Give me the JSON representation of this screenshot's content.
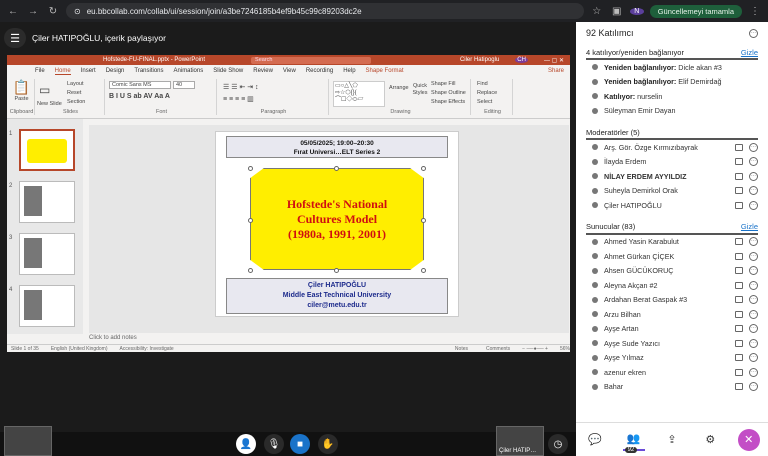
{
  "browser": {
    "url": "eu.bbcollab.com/collab/ui/session/join/a3be7246185b4ef9b45c99c89203dc2e",
    "update": "Güncellemeyi tamamla",
    "profile": "N"
  },
  "share": {
    "text": "Çiler HATIPOĞLU, içerik paylaşıyor"
  },
  "ppt": {
    "file": "Hofstede-FU-FINAL.pptx - PowerPoint",
    "search": "Search",
    "user": "Ciler Hatipoglu",
    "initials": "CH",
    "tabs": [
      "File",
      "Home",
      "Insert",
      "Design",
      "Transitions",
      "Animations",
      "Slide Show",
      "Review",
      "View",
      "Recording",
      "Help",
      "Shape Format"
    ],
    "share": "Share",
    "groups": [
      "Clipboard",
      "Slides",
      "Font",
      "Paragraph",
      "Drawing",
      "Editing"
    ],
    "font": "Comic Sans MS",
    "size": "40",
    "ribbon": {
      "paste": "Paste",
      "new_slide": "New Slide",
      "layout": "Layout",
      "reset": "Reset",
      "section": "Section",
      "arrange": "Arrange",
      "quick_styles": "Quick Styles",
      "shape_fill": "Shape Fill",
      "shape_outline": "Shape Outline",
      "shape_effects": "Shape Effects",
      "find": "Find",
      "replace": "Replace",
      "select": "Select"
    },
    "thumb_nums": [
      "1",
      "2",
      "3",
      "4"
    ],
    "slide": {
      "date": "05/05/2025; 19:00–20:30",
      "event": "Fırat Universi…ELT Series 2",
      "title1": "Hofstede's National",
      "title2": "Cultures Model",
      "title3": "(1980a, 1991, 2001)",
      "author": "Çiler HATIPOĞLU",
      "uni": "Middle East Technical University",
      "email": "ciler@metu.edu.tr"
    },
    "notes": "Click to add notes",
    "status": {
      "slide": "Slide 1 of 35",
      "lang": "English (United Kingdom)",
      "acc": "Accessibility: Investigate",
      "notes": "Notes",
      "comments": "Comments",
      "zoom": "56%"
    }
  },
  "side": {
    "title": "92 Katılımcı",
    "joining": {
      "title": "4 katılıyor/yeniden bağlanıyor",
      "hide": "Gizle",
      "items": [
        {
          "label": "Yeniden bağlanılıyor:",
          "name": "Dicle akan #3"
        },
        {
          "label": "Yeniden bağlanılıyor:",
          "name": "Elif Demirdağ"
        },
        {
          "label": "Katılıyor:",
          "name": "nurselin"
        },
        {
          "label": "",
          "name": "Süleyman Emir Dayan"
        }
      ]
    },
    "mods": {
      "title": "Moderatörler (5)",
      "items": [
        "Arş. Gör. Özge Kırmızıbayrak",
        "İlayda Erdem",
        "NİLAY ERDEM AYYILDIZ",
        "Suheyla Demirkol Orak",
        "Çiler HATIPOĞLU"
      ]
    },
    "pres": {
      "title": "Sunucular (83)",
      "hide": "Gizle",
      "items": [
        "Ahmed Yasin Karabulut",
        "Ahmet Gürkan ÇİÇEK",
        "Ahsen GÜCÜKORUÇ",
        "Aleyna Akçan #2",
        "Ardahan Berat Gaspak #3",
        "Arzu Bilhan",
        "Ayşe Artan",
        "Ayşe Sude Yazıcı",
        "Ayşe Yılmaz",
        "azenur ekren",
        "Bahar"
      ]
    },
    "count": "92"
  },
  "cam_label": "Çiler HATIP…"
}
